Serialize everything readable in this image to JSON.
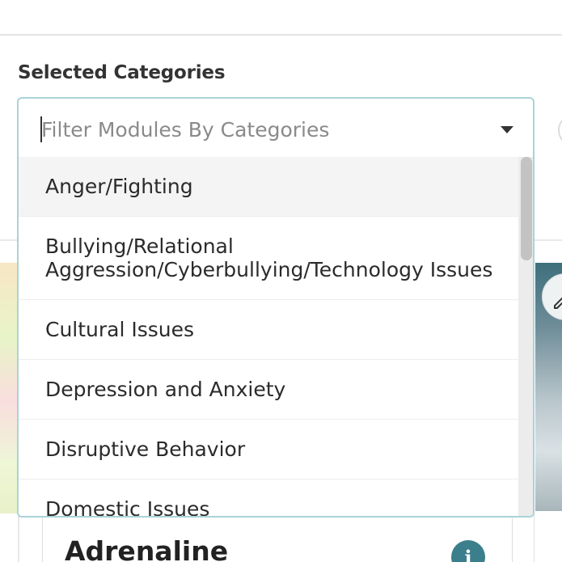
{
  "section": {
    "label": "Selected Categories"
  },
  "filter": {
    "placeholder": "Filter Modules By Categories",
    "value": ""
  },
  "options": [
    {
      "label": "Anger/Fighting",
      "highlighted": true
    },
    {
      "label": "Bullying/Relational Aggression/Cyberbullying/Technology Issues"
    },
    {
      "label": "Cultural Issues"
    },
    {
      "label": "Depression and Anxiety"
    },
    {
      "label": "Disruptive Behavior"
    },
    {
      "label": "Domestic Issues"
    }
  ],
  "card": {
    "title": "Adrenaline",
    "info_icon": "info-icon",
    "edit_icon": "edit-pencil-icon"
  },
  "colors": {
    "accent": "#3b7f8c",
    "border_focus": "#a9d3d8"
  }
}
